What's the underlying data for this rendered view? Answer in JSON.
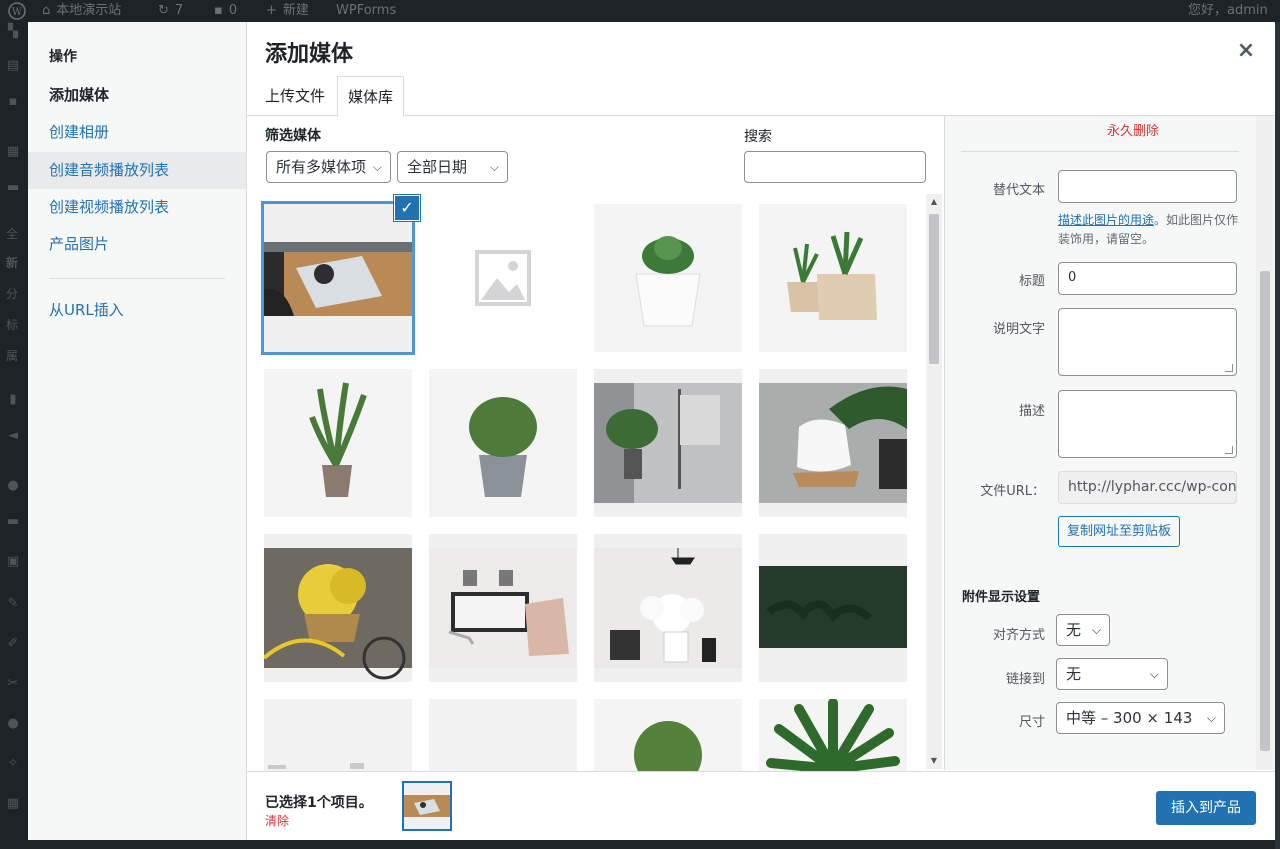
{
  "adminbar": {
    "site_name": "本地演示站",
    "updates_count": "7",
    "comments_count": "0",
    "new_label": "新建",
    "plugin_label": "WPForms",
    "greeting": "您好，admin"
  },
  "adminmenu_fragments": [
    "全",
    "新",
    "分",
    "标",
    "属"
  ],
  "menu": {
    "heading": "操作",
    "items": [
      {
        "label": "添加媒体",
        "active": true
      },
      {
        "label": "创建相册"
      },
      {
        "label": "创建音频播放列表"
      },
      {
        "label": "创建视频播放列表"
      },
      {
        "label": "产品图片"
      }
    ],
    "url_insert": "从URL插入"
  },
  "modal": {
    "title": "添加媒体",
    "close_icon": "×",
    "tabs": [
      {
        "label": "上传文件"
      },
      {
        "label": "媒体库",
        "active": true
      }
    ]
  },
  "toolbar": {
    "filter_label": "筛选媒体",
    "type_filter": "所有多媒体项",
    "date_filter": "全部日期",
    "search_label": "搜索",
    "search_value": ""
  },
  "attachments": [
    {
      "name": "phone-on-desk",
      "selected": true
    },
    {
      "name": "placeholder-image"
    },
    {
      "name": "succulent-white-pot"
    },
    {
      "name": "two-plants-geometric-pots"
    },
    {
      "name": "snake-plant"
    },
    {
      "name": "rosemary-grey-pot"
    },
    {
      "name": "room-with-plant"
    },
    {
      "name": "white-chair-palm"
    },
    {
      "name": "yellow-flowers-bicycle"
    },
    {
      "name": "living-room-shelf"
    },
    {
      "name": "white-flowers-table"
    },
    {
      "name": "dark-green-leaves"
    },
    {
      "name": "light-item-1"
    },
    {
      "name": "light-item-2"
    },
    {
      "name": "round-bush"
    },
    {
      "name": "dracaena-plant"
    }
  ],
  "details": {
    "delete_link": "永久删除",
    "alt_label": "替代文本",
    "alt_value": "",
    "alt_help_link": "描述此图片的用途",
    "alt_help_text": "。如此图片仅作装饰用，请留空。",
    "title_label": "标题",
    "title_value": "0",
    "caption_label": "说明文字",
    "description_label": "描述",
    "url_label": "文件URL：",
    "url_value": "http://lyphar.ccc/wp-content/uploads/",
    "copy_button": "复制网址至剪贴板"
  },
  "display_settings": {
    "heading": "附件显示设置",
    "align_label": "对齐方式",
    "align_value": "无",
    "link_label": "链接到",
    "link_value": "无",
    "size_label": "尺寸",
    "size_value": "中等 – 300 × 143"
  },
  "footer": {
    "selection_count": "已选择1个项目。",
    "clear_link": "清除",
    "insert_button": "插入到产品"
  },
  "colors": {
    "accent": "#2271b1",
    "danger": "#d63638",
    "admin_bg": "#1d2327"
  }
}
